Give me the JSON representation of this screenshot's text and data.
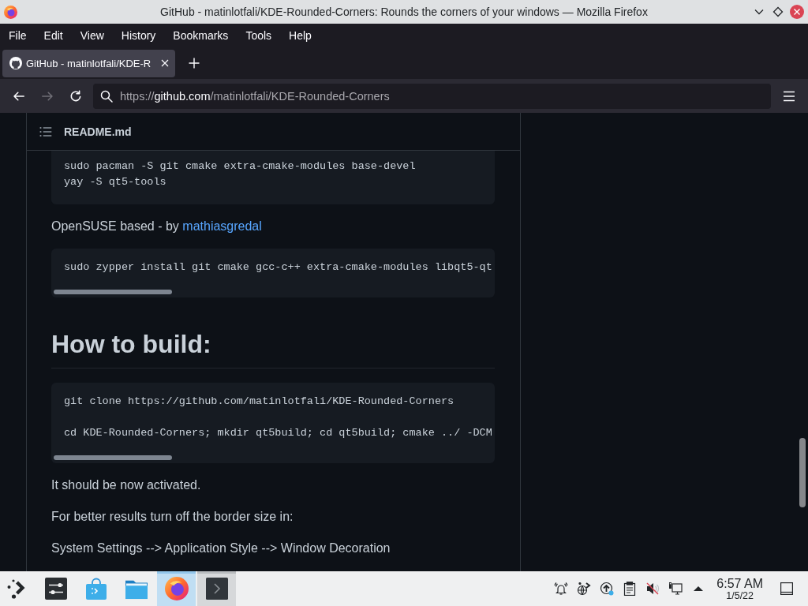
{
  "window": {
    "title": "GitHub - matinlotfali/KDE-Rounded-Corners: Rounds the corners of your windows — Mozilla Firefox"
  },
  "menu_bar": [
    {
      "label": "File"
    },
    {
      "label": "Edit"
    },
    {
      "label": "View"
    },
    {
      "label": "History"
    },
    {
      "label": "Bookmarks"
    },
    {
      "label": "Tools"
    },
    {
      "label": "Help"
    }
  ],
  "tabs": [
    {
      "label": "GitHub - matinlotfali/KDE-R",
      "selected": true
    }
  ],
  "toolbar": {
    "buttons": [
      {
        "kind": "back",
        "disabled": false
      },
      {
        "kind": "forward",
        "disabled": true
      },
      {
        "kind": "reload",
        "disabled": false
      }
    ],
    "url": {
      "scheme": "https://",
      "host": "github.com",
      "path": "/matinlotfali/KDE-Rounded-Corners"
    }
  },
  "readme": {
    "title": "README.md",
    "blocks": [
      {
        "kind": "code",
        "groups": [
          [
            "sudo pacman -S git cmake extra-cmake-modules base-devel",
            "yay -S qt5-tools"
          ]
        ],
        "scrollable": false
      },
      {
        "kind": "paragraph",
        "text": "OpenSUSE based - by",
        "link": "mathiasgredal"
      },
      {
        "kind": "code",
        "groups": [
          [
            "sudo zypper install git cmake gcc-c++ extra-cmake-modules libqt5-qt"
          ]
        ],
        "scrollable": true
      },
      {
        "kind": "heading",
        "text": "How to build:"
      },
      {
        "kind": "code",
        "groups": [
          [
            "git clone https://github.com/matinlotfali/KDE-Rounded-Corners"
          ],
          [
            "cd KDE-Rounded-Corners; mkdir qt5build; cd qt5build; cmake ../ -DCM"
          ]
        ],
        "scrollable": true
      },
      {
        "kind": "paragraph",
        "text": "It should be now activated."
      },
      {
        "kind": "paragraph",
        "text": "For better results turn off the border size in:"
      },
      {
        "kind": "paragraph",
        "text": "System Settings --> Application Style --> Window Decoration"
      }
    ]
  },
  "taskbar": {
    "tasks": [
      {
        "kind": "launcher",
        "selected": false,
        "open": false
      },
      {
        "kind": "settings",
        "selected": false,
        "open": false
      },
      {
        "kind": "store",
        "selected": false,
        "open": false
      },
      {
        "kind": "files",
        "selected": false,
        "open": false
      },
      {
        "kind": "browser",
        "selected": true,
        "open": true
      },
      {
        "kind": "terminal",
        "selected": false,
        "open": true
      }
    ],
    "clock": {
      "time": "6:57 AM",
      "date": "1/5/22"
    }
  }
}
